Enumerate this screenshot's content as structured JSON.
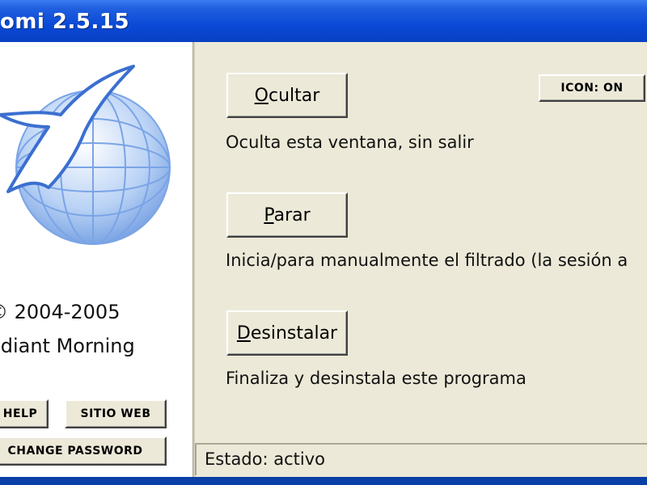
{
  "window": {
    "title": "omi 2.5.15"
  },
  "left": {
    "copyright": "2004-2005",
    "company": "adiant Morning",
    "help_label": "HELP",
    "website_label": "SITIO WEB",
    "password_label": "CHANGE PASSWORD"
  },
  "main": {
    "icon_toggle_label": "ICON: ON",
    "hide": {
      "label_first": "O",
      "label_rest": "cultar",
      "description": "Oculta esta ventana, sin salir"
    },
    "stop": {
      "label_first": "P",
      "label_rest": "arar",
      "description": "Inicia/para manualmente el filtrado (la sesión a"
    },
    "uninstall": {
      "label_first": "D",
      "label_rest": "esinstalar",
      "description": "Finaliza y desinstala este programa"
    }
  },
  "status": {
    "text": "Estado: activo"
  },
  "colors": {
    "titlebar": "#0a49d6",
    "window_bg": "#ece9d8",
    "panel_bg": "#ffffff"
  }
}
